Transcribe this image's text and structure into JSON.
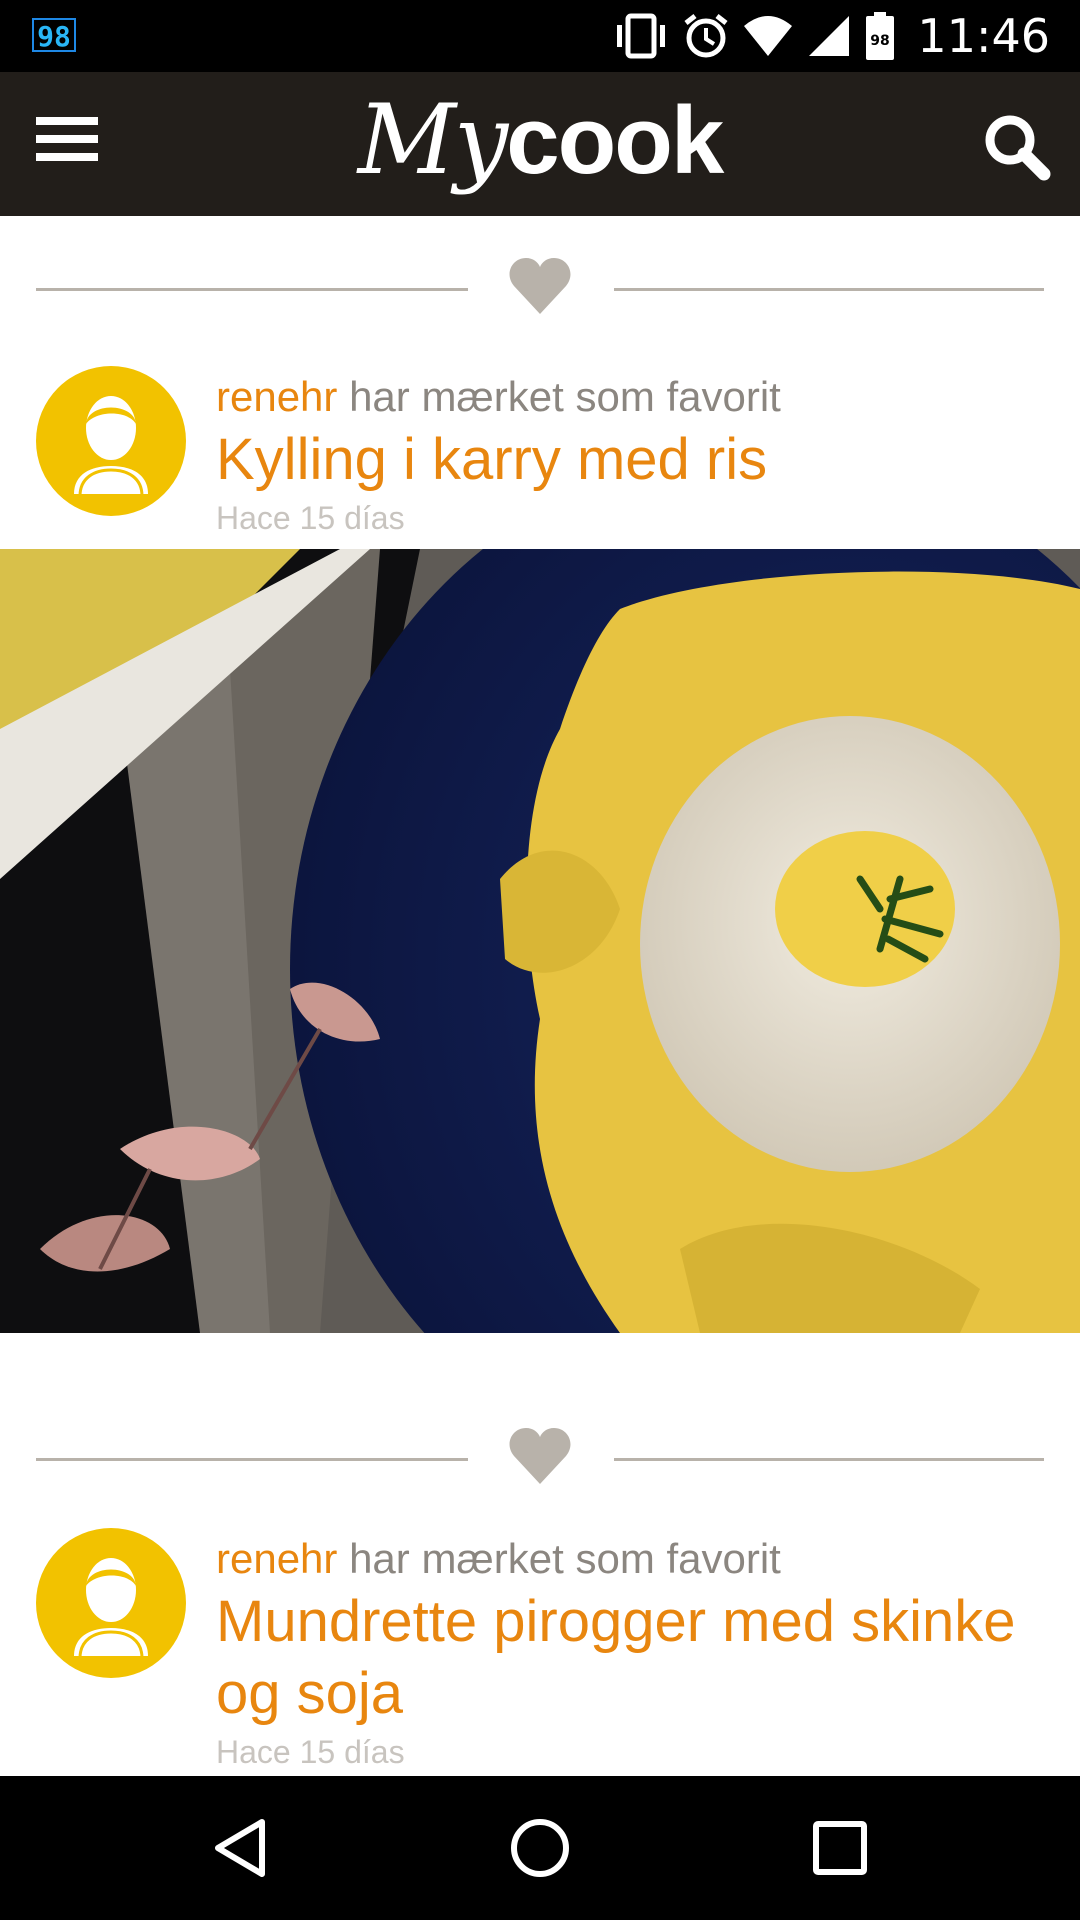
{
  "status_bar": {
    "badge": "98",
    "time": "11:46",
    "battery_label": "98",
    "icons": [
      "vibrate-icon",
      "alarm-icon",
      "wifi-icon",
      "signal-icon",
      "battery-icon"
    ]
  },
  "app_bar": {
    "logo_my": "My",
    "logo_cook": "cook",
    "menu_icon": "hamburger-menu-icon",
    "search_icon": "search-icon"
  },
  "feed": [
    {
      "user": "renehr",
      "action": " har mærket som favorit",
      "title": "Kylling i karry med ris",
      "time": "Hace 15 días",
      "image": "curry-chicken-with-rice-photo"
    },
    {
      "user": "renehr",
      "action": " har mærket som favorit",
      "title": "Mundrette pirogger med skinke og soja",
      "time": "Hace 15 días"
    }
  ],
  "nav_bar": {
    "buttons": [
      "back-icon",
      "home-icon",
      "recents-icon"
    ]
  },
  "colors": {
    "accent": "#e8860f",
    "app_bar": "#221e1a",
    "avatar": "#f2c200",
    "muted_text": "#8b8680"
  }
}
